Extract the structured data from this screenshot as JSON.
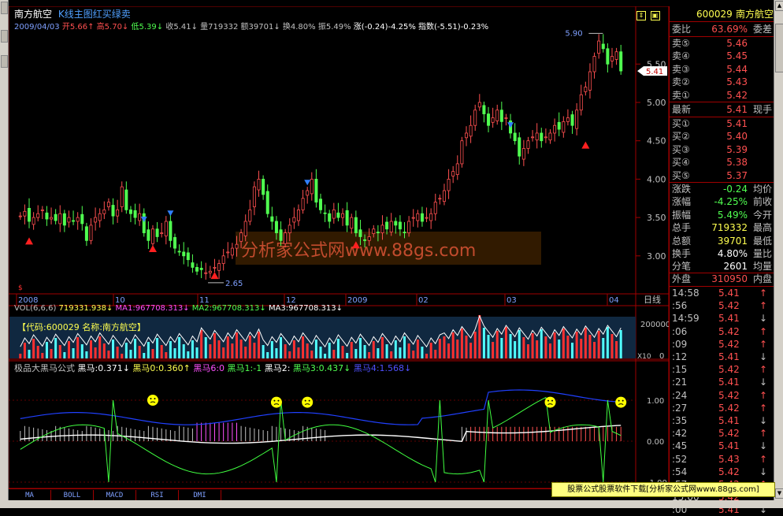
{
  "chart": {
    "name": "南方航空",
    "formula": "K线主图红买绿卖",
    "date": "2009/04/03",
    "ohlc_line": [
      {
        "t": "开5.66↑",
        "c": "#ff5050"
      },
      {
        "t": "高5.70↓",
        "c": "#ff5050"
      },
      {
        "t": "低5.39↓",
        "c": "#50ff50"
      },
      {
        "t": "收5.41↓",
        "c": "#c0c0c0"
      },
      {
        "t": "量719332",
        "c": "#c0c0c0"
      },
      {
        "t": "额39701↓",
        "c": "#c0c0c0"
      },
      {
        "t": "换4.80%",
        "c": "#c0c0c0"
      },
      {
        "t": "振5.49%",
        "c": "#c0c0c0"
      },
      {
        "t": "涨(-0.24)-4.25%",
        "c": "#ffffff"
      },
      {
        "t": "指数(-5.51)-0.23%",
        "c": "#ffffff"
      }
    ],
    "price_axis": [
      "5.50",
      "5.00",
      "4.50",
      "4.00",
      "3.50",
      "3.00"
    ],
    "current_price_tag": "5.41",
    "high_label": "5.90",
    "low_label": "2.65",
    "watermark": "分析家公式网www.88gs.com",
    "time_axis": [
      "2008",
      "10",
      "11",
      "12",
      "2009",
      "02",
      "03",
      "04"
    ],
    "period": "日线",
    "vol_line": [
      {
        "t": "VOL(6,6,6)",
        "c": "#c0c0c0"
      },
      {
        "t": "719331.938↓",
        "c": "#ffff50"
      },
      {
        "t": "MA1:967708.313↓",
        "c": "#ff50ff"
      },
      {
        "t": "MA2:967708.313↓",
        "c": "#50ff50"
      },
      {
        "t": "MA3:967708.313↓",
        "c": "#ffffff"
      }
    ],
    "vol_axis": [
      "200000",
      "0"
    ],
    "vol_unit": "X10",
    "code_box": "【代码:600029 名称:南方航空】",
    "ind_line": [
      {
        "t": "极品大黑马公式",
        "c": "#c0c0c0"
      },
      {
        "t": "黑马:0.371↓",
        "c": "#ffffff"
      },
      {
        "t": "黑马0:0.360↑",
        "c": "#ffff50"
      },
      {
        "t": "黑马6:0",
        "c": "#ff50ff"
      },
      {
        "t": "黑马1:-1",
        "c": "#50ff50"
      },
      {
        "t": "黑马2:",
        "c": "#ffffff"
      },
      {
        "t": "黑马3:0.437↓",
        "c": "#50ff50"
      },
      {
        "t": "黑马4:1.568↓",
        "c": "#5050ff"
      }
    ],
    "ind_axis": [
      "1.00",
      "0.00",
      "-1.00"
    ]
  },
  "tabs": [
    "MA",
    "BOLL",
    "MACD",
    "RSI",
    "DMI"
  ],
  "ad_text": "股票公式股票软件下载[分析家公式网www.88gs.com]",
  "quote": {
    "code": "600029",
    "name": "南方航空",
    "ratio": {
      "k": "委比",
      "v": "63.69%",
      "e": "委差"
    },
    "sells": [
      {
        "k": "卖⑤",
        "v": "5.46"
      },
      {
        "k": "卖④",
        "v": "5.45"
      },
      {
        "k": "卖③",
        "v": "5.44"
      },
      {
        "k": "卖②",
        "v": "5.43"
      },
      {
        "k": "卖①",
        "v": "5.42"
      }
    ],
    "latest": {
      "k": "最新",
      "v": "5.41",
      "e": "现手"
    },
    "buys": [
      {
        "k": "买①",
        "v": "5.41"
      },
      {
        "k": "买②",
        "v": "5.40"
      },
      {
        "k": "买③",
        "v": "5.39"
      },
      {
        "k": "买④",
        "v": "5.38"
      },
      {
        "k": "买⑤",
        "v": "5.37"
      }
    ],
    "stats": [
      {
        "k": "涨跌",
        "v": "-0.24",
        "e": "均价"
      },
      {
        "k": "涨幅",
        "v": "-4.25%",
        "e": "前收"
      },
      {
        "k": "振幅",
        "v": "5.49%",
        "e": "今开"
      },
      {
        "k": "总手",
        "v": "719332",
        "e": "最高"
      },
      {
        "k": "总额",
        "v": "39701",
        "e": "最低"
      },
      {
        "k": "换手",
        "v": "4.80%",
        "e": "量比"
      },
      {
        "k": "分笔",
        "v": "2601",
        "e": "均量"
      }
    ],
    "outer": {
      "k": "外盘",
      "v": "310950",
      "e": "内盘"
    },
    "ticks": [
      {
        "t": "14:58",
        "p": "5.41",
        "a": "↑"
      },
      {
        "t": ":56",
        "p": "5.42",
        "a": "↑"
      },
      {
        "t": "14:59",
        "p": "5.41",
        "a": "↓"
      },
      {
        "t": ":06",
        "p": "5.42",
        "a": "↑"
      },
      {
        "t": ":09",
        "p": "5.42",
        "a": "↑"
      },
      {
        "t": ":12",
        "p": "5.41",
        "a": "↓"
      },
      {
        "t": ":15",
        "p": "5.42",
        "a": "↑"
      },
      {
        "t": ":21",
        "p": "5.41",
        "a": "↓"
      },
      {
        "t": ":24",
        "p": "5.42",
        "a": "↑"
      },
      {
        "t": ":27",
        "p": "5.42",
        "a": "↑"
      },
      {
        "t": ":35",
        "p": "5.41",
        "a": "↓"
      },
      {
        "t": ":42",
        "p": "5.42",
        "a": "↑"
      },
      {
        "t": ":45",
        "p": "5.41",
        "a": "↓"
      },
      {
        "t": ":52",
        "p": "5.43",
        "a": "↑"
      },
      {
        "t": ":54",
        "p": "5.42",
        "a": "↓"
      },
      {
        "t": ":57",
        "p": "5.42",
        "a": "↑"
      },
      {
        "t": "15:00",
        "p": "5.42",
        "a": ""
      },
      {
        "t": ":00",
        "p": "5.41",
        "a": "↓"
      }
    ]
  },
  "colors": {
    "up": "#ff5050",
    "down": "#50ff50",
    "frame": "#a00000",
    "blue": "#3060ff"
  }
}
